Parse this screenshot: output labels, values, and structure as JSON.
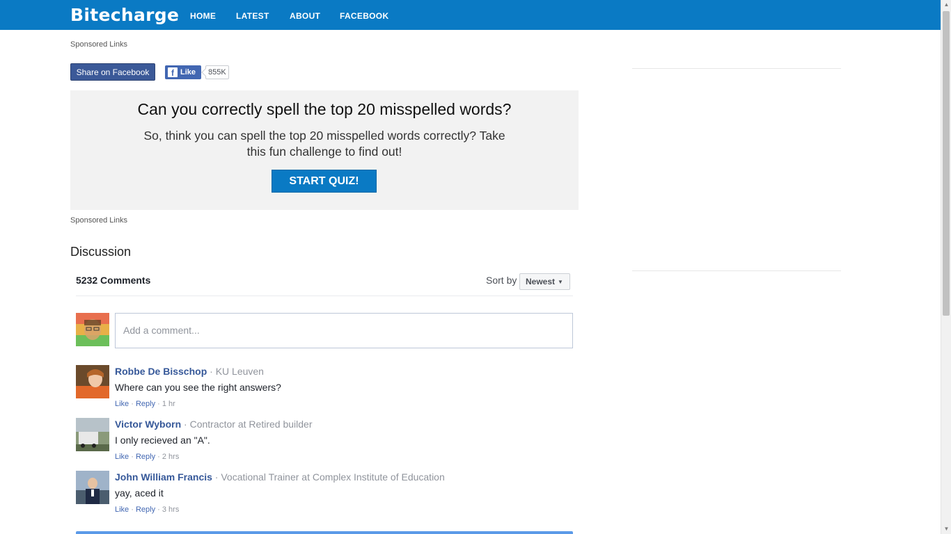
{
  "header": {
    "brand": "Bitecharge",
    "nav": [
      "HOME",
      "LATEST",
      "ABOUT",
      "FACEBOOK"
    ]
  },
  "sponsored_top": "Sponsored Links",
  "sponsored_bottom": "Sponsored Links",
  "social": {
    "share_label": "Share on Facebook",
    "like_label": "Like",
    "like_count": "855K"
  },
  "quiz": {
    "title": "Can you correctly spell the top 20 misspelled words?",
    "description": "So, think you can spell the top 20 misspelled words correctly? Take this fun challenge to find out!",
    "button": "START QUIZ!"
  },
  "discussion": {
    "title": "Discussion",
    "count": "5232 Comments",
    "sort_label": "Sort by",
    "sort_value": "Newest",
    "input_placeholder": "Add a comment...",
    "comments": [
      {
        "name": "Robbe De Bisschop",
        "meta": " · KU Leuven",
        "text": "Where can you see the right answers?",
        "like": "Like",
        "reply": "Reply",
        "time": "1 hr"
      },
      {
        "name": "Victor Wyborn",
        "meta": " · Contractor at Retired builder",
        "text": "I only recieved an \"A\".",
        "like": "Like",
        "reply": "Reply",
        "time": "2 hrs"
      },
      {
        "name": "John William Francis",
        "meta": " · Vocational Trainer at Complex Institute of Education",
        "text": "yay, aced it",
        "like": "Like",
        "reply": "Reply",
        "time": "3 hrs"
      }
    ]
  },
  "colors": {
    "brand_blue": "#0a7ac4",
    "facebook_blue": "#3b5998",
    "name_link": "#365899"
  }
}
